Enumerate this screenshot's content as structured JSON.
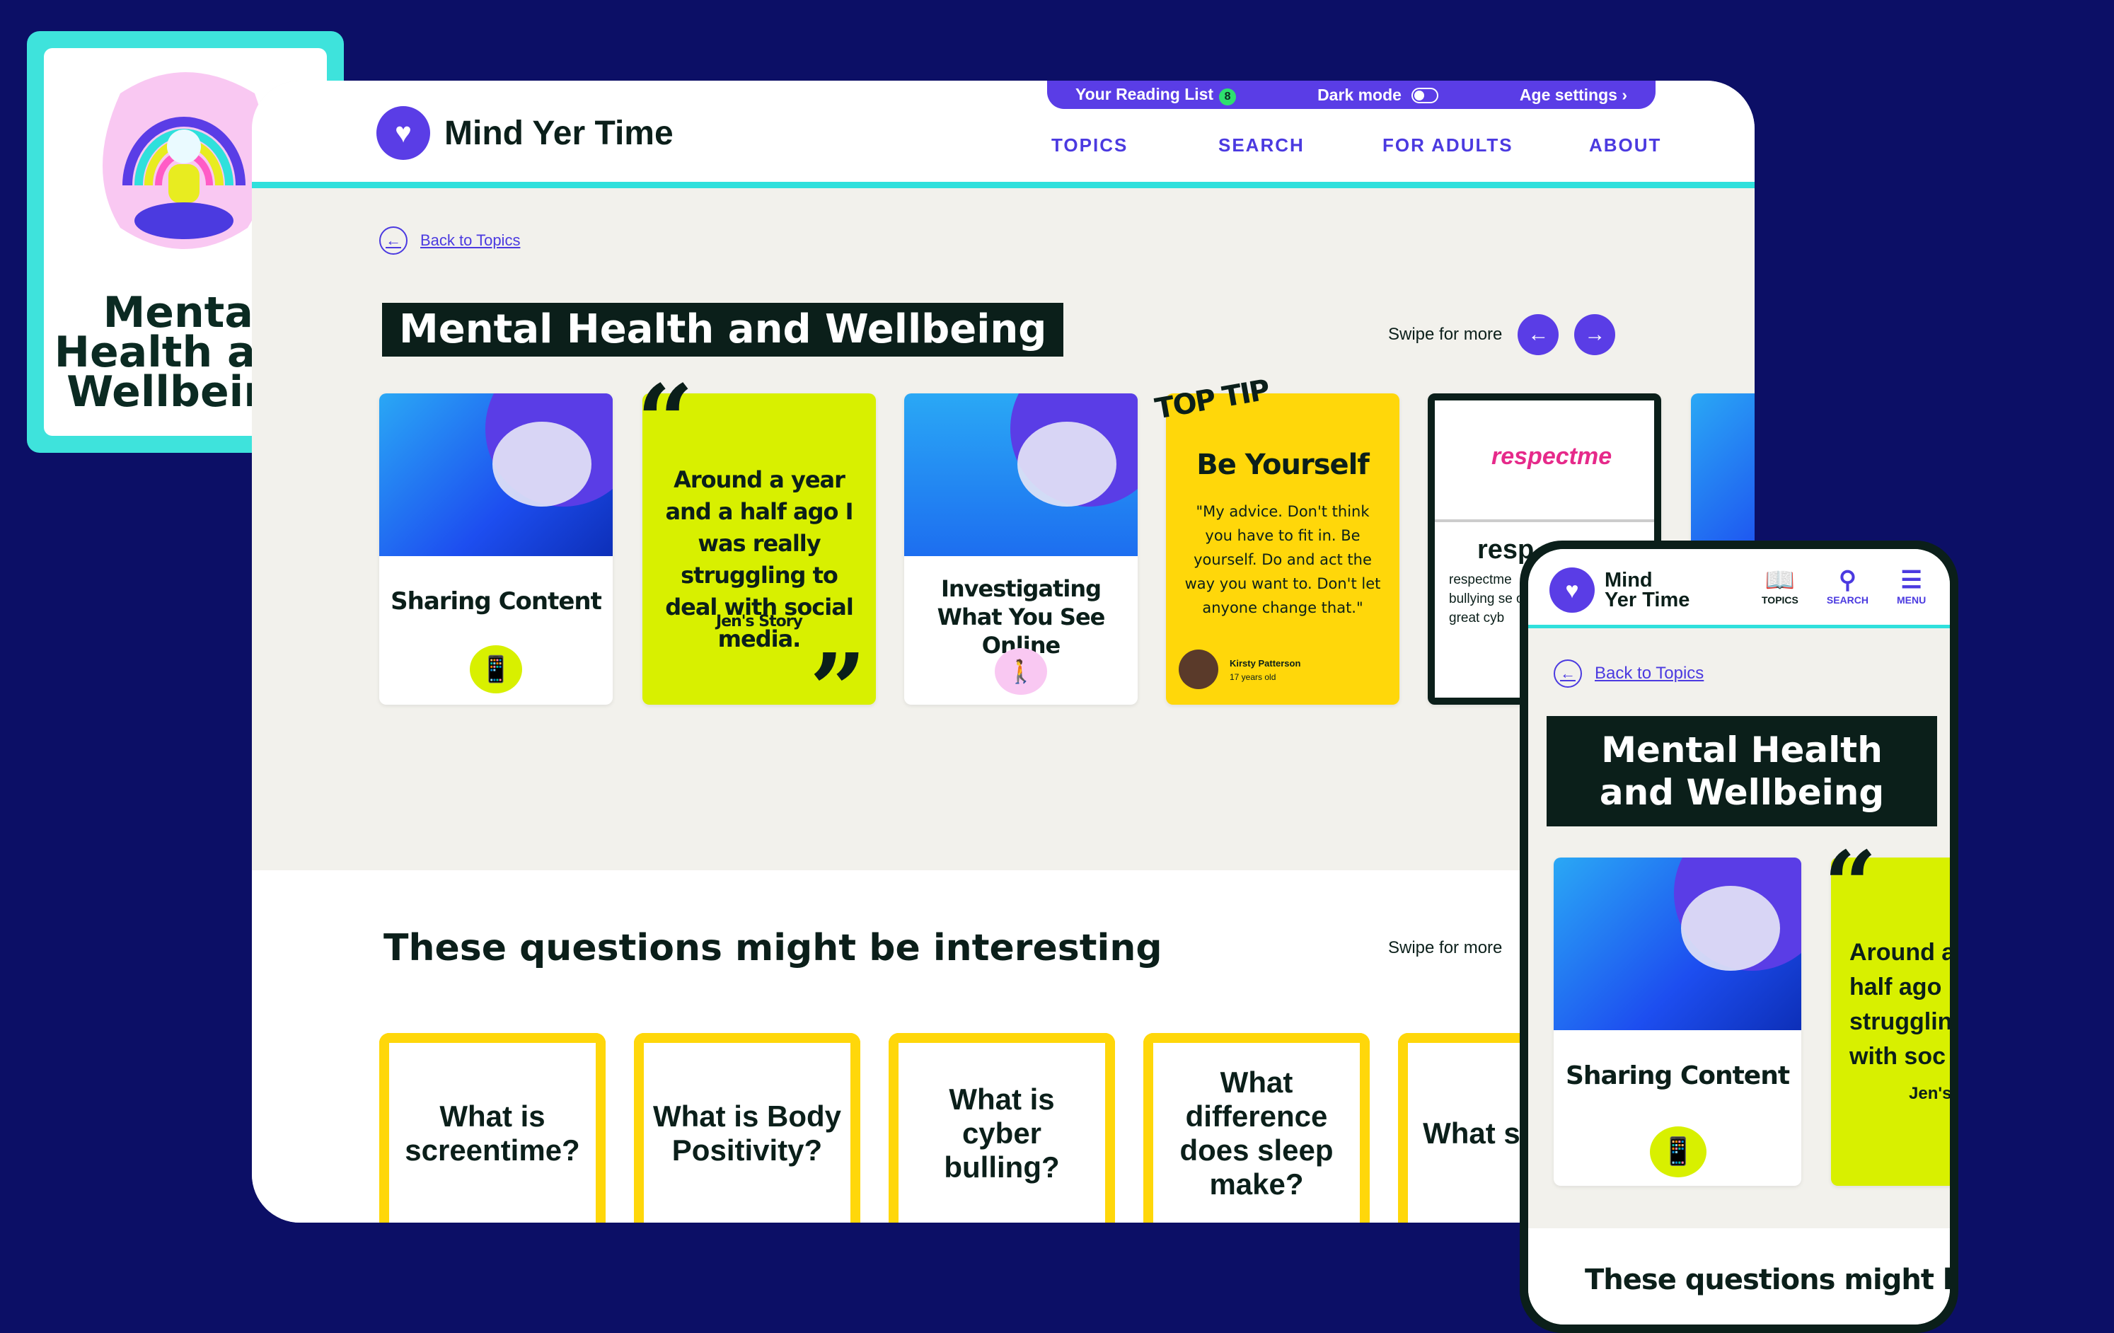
{
  "promo": {
    "title": "Mental Health and Wellbeing"
  },
  "desktop": {
    "logo_name": "Mind Yer Time",
    "util": {
      "reading_list": "Your Reading List",
      "reading_count": "8",
      "dark_mode": "Dark mode",
      "age_settings": "Age settings"
    },
    "nav": [
      "TOPICS",
      "SEARCH",
      "FOR ADULTS",
      "ABOUT"
    ],
    "back_label": "Back to Topics",
    "page_title": "Mental Health and Wellbeing",
    "swipe_label": "Swipe for more",
    "cards": {
      "sharing": "Sharing Content",
      "quote_text": "Around a year and a half ago I was really struggling to deal with social media.",
      "quote_source": "Jen's Story",
      "investigating": "Investigating What You See Online",
      "top_tip_tag": "TOP TIP",
      "tip_title": "Be Yourself",
      "tip_text": "\"My advice. Don't think you have to fit in. Be yourself. Do and act the way you want to. Don't let anyone change that.\"",
      "tip_author": "Kirsty Patterson",
      "tip_age": "17 years old",
      "respect_logo": "respectme",
      "respect_title": "resp",
      "respect_text": "respectme bullying se of great cyb"
    },
    "questions_title": "These questions might be interesting",
    "questions": [
      "What is screentime?",
      "What is Body Positivity?",
      "What is cyber bulling?",
      "What difference does sleep make?",
      "What screen"
    ]
  },
  "mobile": {
    "logo_line1": "Mind",
    "logo_line2": "Yer Time",
    "tabs": [
      {
        "label": "TOPICS",
        "icon": "book-icon"
      },
      {
        "label": "SEARCH",
        "icon": "search-icon"
      },
      {
        "label": "MENU",
        "icon": "menu-icon"
      }
    ],
    "back_label": "Back to Topics",
    "page_title": "Mental Health and Wellbeing",
    "card_title": "Sharing Content",
    "quote_text": "Around a half ago I strugglin with soc",
    "quote_source": "Jen's",
    "questions_title": "These questions might be"
  },
  "colors": {
    "background": "#0c0f66",
    "brand_purple": "#5a3de6",
    "teal": "#2fe0dc",
    "lime": "#d8f000",
    "yellow": "#ffd70a",
    "dark": "#0b1f1a"
  }
}
